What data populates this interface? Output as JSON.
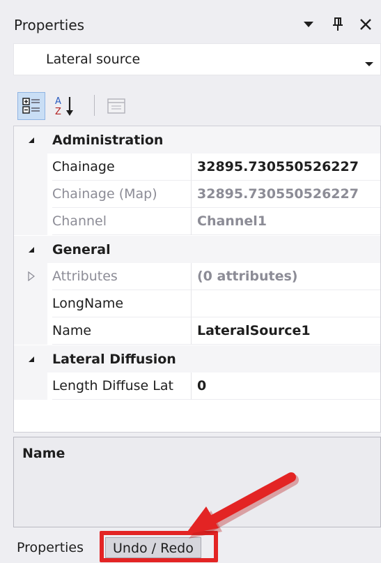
{
  "panel": {
    "title": "Properties",
    "selected_object": "Lateral source"
  },
  "grid": {
    "categories": [
      {
        "label": "Administration",
        "properties": [
          {
            "name": "Chainage",
            "value": "32895.730550526227",
            "readonly": false
          },
          {
            "name": "Chainage (Map)",
            "value": "32895.730550526227",
            "readonly": true
          },
          {
            "name": "Channel",
            "value": "Channel1",
            "readonly": true
          }
        ]
      },
      {
        "label": "General",
        "properties": [
          {
            "name": "Attributes",
            "value": "(0 attributes)",
            "readonly": true
          },
          {
            "name": "LongName",
            "value": "",
            "readonly": false
          },
          {
            "name": "Name",
            "value": "LateralSource1",
            "readonly": false
          }
        ]
      },
      {
        "label": "Lateral Diffusion",
        "properties": [
          {
            "name": "Length Diffuse Lat",
            "value": "0",
            "readonly": false
          }
        ]
      }
    ]
  },
  "description": {
    "title": "Name"
  },
  "tabs": {
    "properties": "Properties",
    "undo_redo": "Undo / Redo"
  },
  "colors": {
    "highlight": "#e32424",
    "accent": "#c9def5"
  }
}
